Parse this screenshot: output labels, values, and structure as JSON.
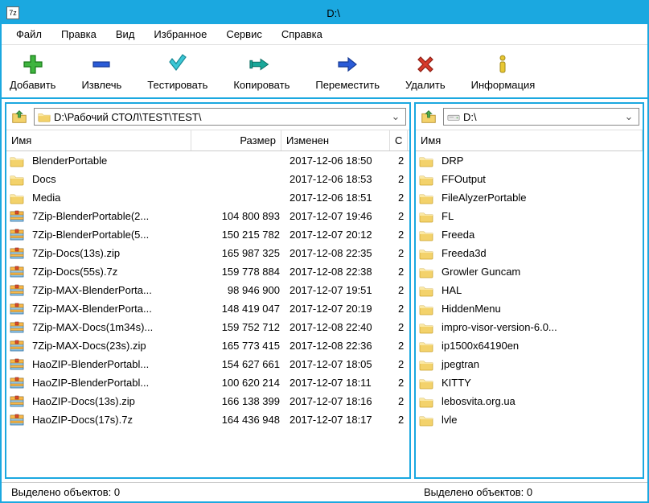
{
  "window": {
    "title": "D:\\",
    "app_icon_label": "7z"
  },
  "menu": {
    "file": "Файл",
    "edit": "Правка",
    "view": "Вид",
    "favorites": "Избранное",
    "tools": "Сервис",
    "help": "Справка"
  },
  "toolbar": {
    "add": "Добавить",
    "extract": "Извлечь",
    "test": "Тестировать",
    "copy": "Копировать",
    "move": "Переместить",
    "delete": "Удалить",
    "info": "Информация"
  },
  "left_panel": {
    "path": "D:\\Рабочий СТОЛ\\TEST\\TEST\\",
    "headers": {
      "name": "Имя",
      "size": "Размер",
      "modified": "Изменен",
      "created": "С"
    },
    "rows": [
      {
        "icon": "folder",
        "name": "BlenderPortable",
        "size": "",
        "modified": "2017-12-06 18:50",
        "cr": "2"
      },
      {
        "icon": "folder",
        "name": "Docs",
        "size": "",
        "modified": "2017-12-06 18:53",
        "cr": "2"
      },
      {
        "icon": "folder",
        "name": "Media",
        "size": "",
        "modified": "2017-12-06 18:51",
        "cr": "2"
      },
      {
        "icon": "archive",
        "name": "7Zip-BlenderPortable(2...",
        "size": "104 800 893",
        "modified": "2017-12-07 19:46",
        "cr": "2"
      },
      {
        "icon": "archive",
        "name": "7Zip-BlenderPortable(5...",
        "size": "150 215 782",
        "modified": "2017-12-07 20:12",
        "cr": "2"
      },
      {
        "icon": "archive",
        "name": "7Zip-Docs(13s).zip",
        "size": "165 987 325",
        "modified": "2017-12-08 22:35",
        "cr": "2"
      },
      {
        "icon": "archive",
        "name": "7Zip-Docs(55s).7z",
        "size": "159 778 884",
        "modified": "2017-12-08 22:38",
        "cr": "2"
      },
      {
        "icon": "archive",
        "name": "7Zip-MAX-BlenderPorta...",
        "size": "98 946 900",
        "modified": "2017-12-07 19:51",
        "cr": "2"
      },
      {
        "icon": "archive",
        "name": "7Zip-MAX-BlenderPorta...",
        "size": "148 419 047",
        "modified": "2017-12-07 20:19",
        "cr": "2"
      },
      {
        "icon": "archive",
        "name": "7Zip-MAX-Docs(1m34s)...",
        "size": "159 752 712",
        "modified": "2017-12-08 22:40",
        "cr": "2"
      },
      {
        "icon": "archive",
        "name": "7Zip-MAX-Docs(23s).zip",
        "size": "165 773 415",
        "modified": "2017-12-08 22:36",
        "cr": "2"
      },
      {
        "icon": "archive",
        "name": "HaoZIP-BlenderPortabl...",
        "size": "154 627 661",
        "modified": "2017-12-07 18:05",
        "cr": "2"
      },
      {
        "icon": "archive",
        "name": "HaoZIP-BlenderPortabl...",
        "size": "100 620 214",
        "modified": "2017-12-07 18:11",
        "cr": "2"
      },
      {
        "icon": "archive",
        "name": "HaoZIP-Docs(13s).zip",
        "size": "166 138 399",
        "modified": "2017-12-07 18:16",
        "cr": "2"
      },
      {
        "icon": "archive",
        "name": "HaoZIP-Docs(17s).7z",
        "size": "164 436 948",
        "modified": "2017-12-07 18:17",
        "cr": "2"
      }
    ]
  },
  "right_panel": {
    "path": "D:\\",
    "headers": {
      "name": "Имя"
    },
    "rows": [
      {
        "icon": "folder",
        "name": "DRP"
      },
      {
        "icon": "folder",
        "name": "FFOutput"
      },
      {
        "icon": "folder",
        "name": "FileAlyzerPortable"
      },
      {
        "icon": "folder",
        "name": "FL"
      },
      {
        "icon": "folder",
        "name": "Freeda"
      },
      {
        "icon": "folder",
        "name": "Freeda3d"
      },
      {
        "icon": "folder",
        "name": "Growler Guncam"
      },
      {
        "icon": "folder",
        "name": "HAL"
      },
      {
        "icon": "folder",
        "name": "HiddenMenu"
      },
      {
        "icon": "folder",
        "name": "impro-visor-version-6.0..."
      },
      {
        "icon": "folder",
        "name": "ip1500x64190en"
      },
      {
        "icon": "folder",
        "name": "jpegtran"
      },
      {
        "icon": "folder",
        "name": "KITTY"
      },
      {
        "icon": "folder",
        "name": "lebosvita.org.ua"
      },
      {
        "icon": "folder",
        "name": "lvle"
      }
    ]
  },
  "status": {
    "left": "Выделено объектов: 0",
    "right": "Выделено объектов: 0"
  }
}
